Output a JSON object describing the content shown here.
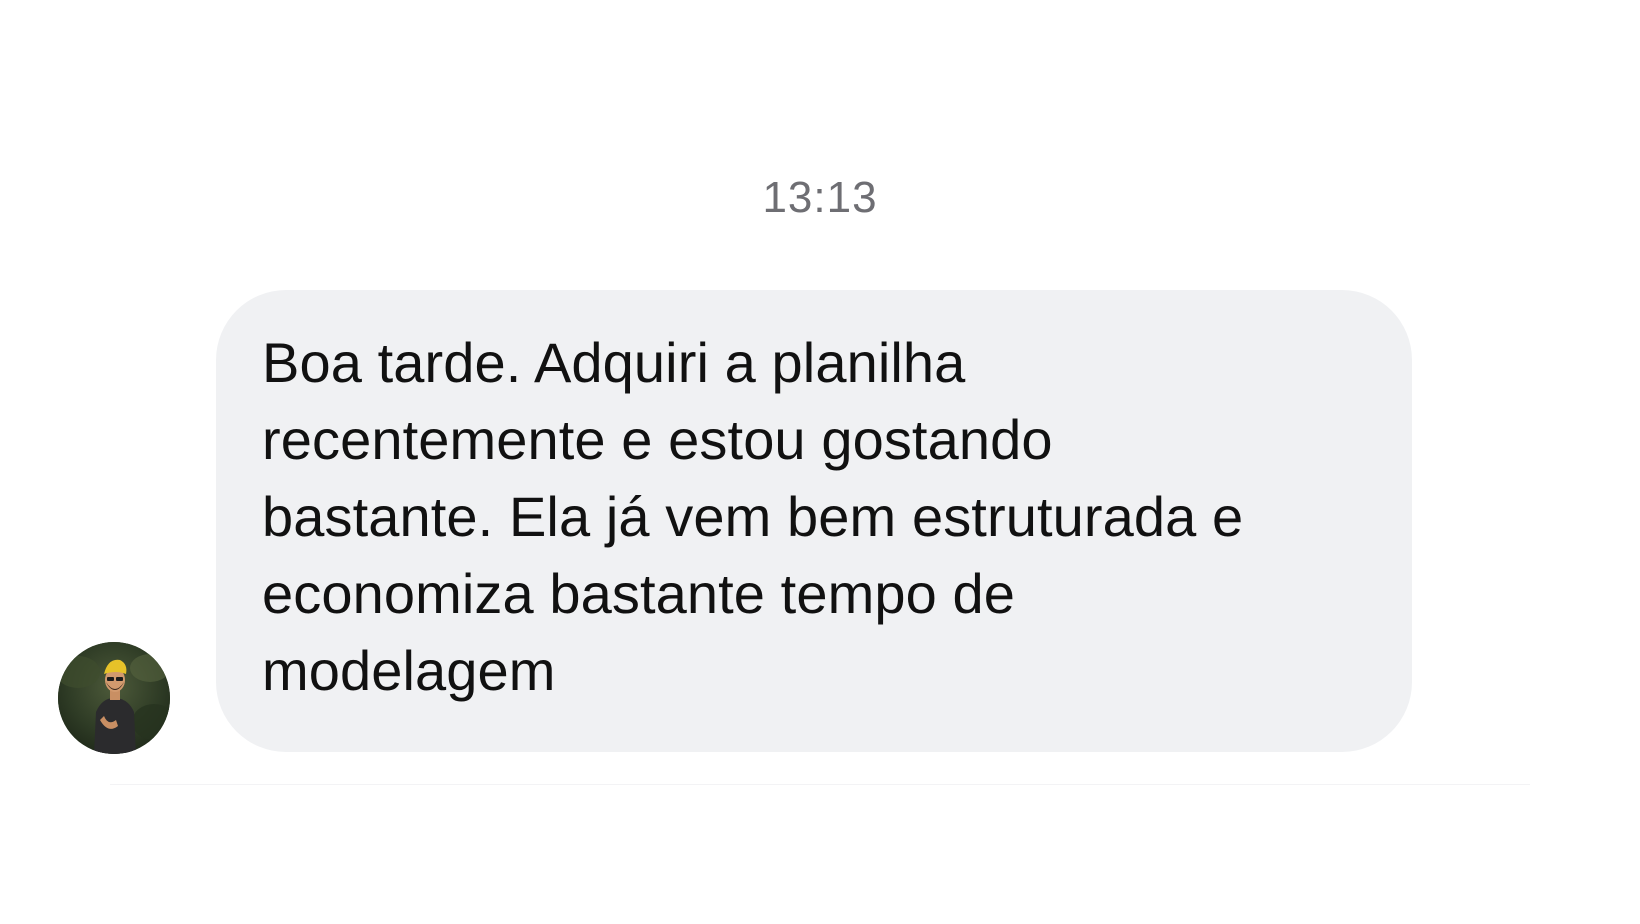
{
  "conversation": {
    "timestamp": "13:13",
    "messages": [
      {
        "sender_avatar": "avatar-photo",
        "text": "Boa tarde. Adquiri a planilha\nrecentemente e estou gostando\nbastante. Ela já vem bem estruturada e\neconomiza bastante tempo de\nmodelagem"
      }
    ]
  },
  "colors": {
    "bubble_background": "#f0f1f3",
    "timestamp_text": "#6e6e73",
    "message_text": "#111111",
    "page_background": "#ffffff"
  }
}
